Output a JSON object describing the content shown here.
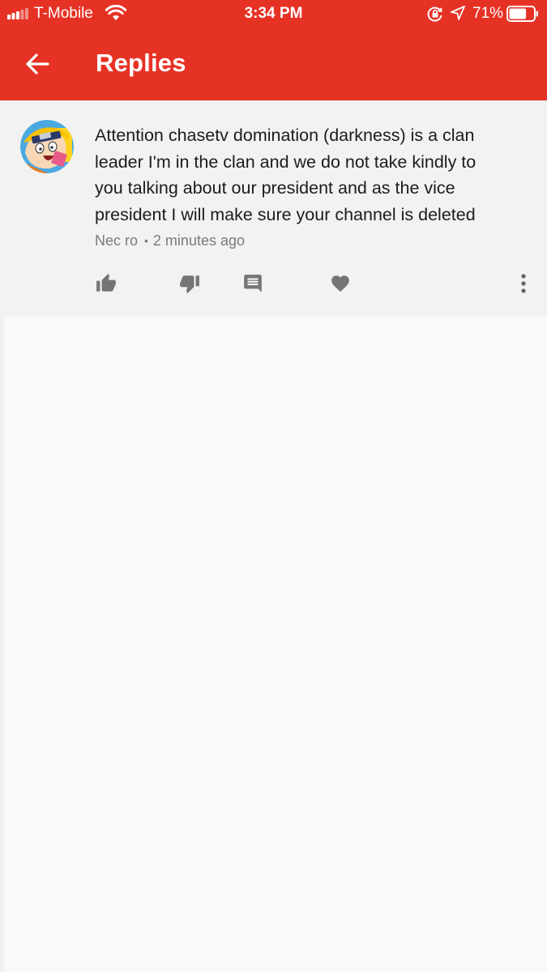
{
  "status_bar": {
    "carrier": "T-Mobile",
    "time": "3:34 PM",
    "battery_percent": "71%",
    "battery_level": 0.71,
    "signal_bars_filled": 3,
    "signal_bars_total": 5,
    "icons": [
      "signal-icon",
      "wifi-icon",
      "orientation-lock-icon",
      "location-arrow-icon",
      "battery-icon"
    ]
  },
  "app_bar": {
    "title": "Replies",
    "back_icon": "back-arrow-icon",
    "background_color": "#e63225"
  },
  "comment": {
    "lines": [
      "Attention chasetv domination (darkness) is a clan",
      "leader I'm in the clan and we do not take kindly to",
      "you talking about our president and as the vice",
      "president I will make sure your channel is deleted"
    ],
    "author": "Nec ro",
    "separator": "•",
    "timestamp": "2 minutes ago",
    "avatar_icon": "avatar-cartoon-icon",
    "actions": {
      "like": "thumbs-up-icon",
      "dislike": "thumbs-down-icon",
      "reply": "reply-comment-icon",
      "heart": "heart-icon",
      "more": "more-vertical-icon"
    }
  },
  "colors": {
    "accent": "#e63225",
    "card_background": "#f2f2f2",
    "page_background": "#f9f9f9",
    "icon_gray": "#757575"
  }
}
